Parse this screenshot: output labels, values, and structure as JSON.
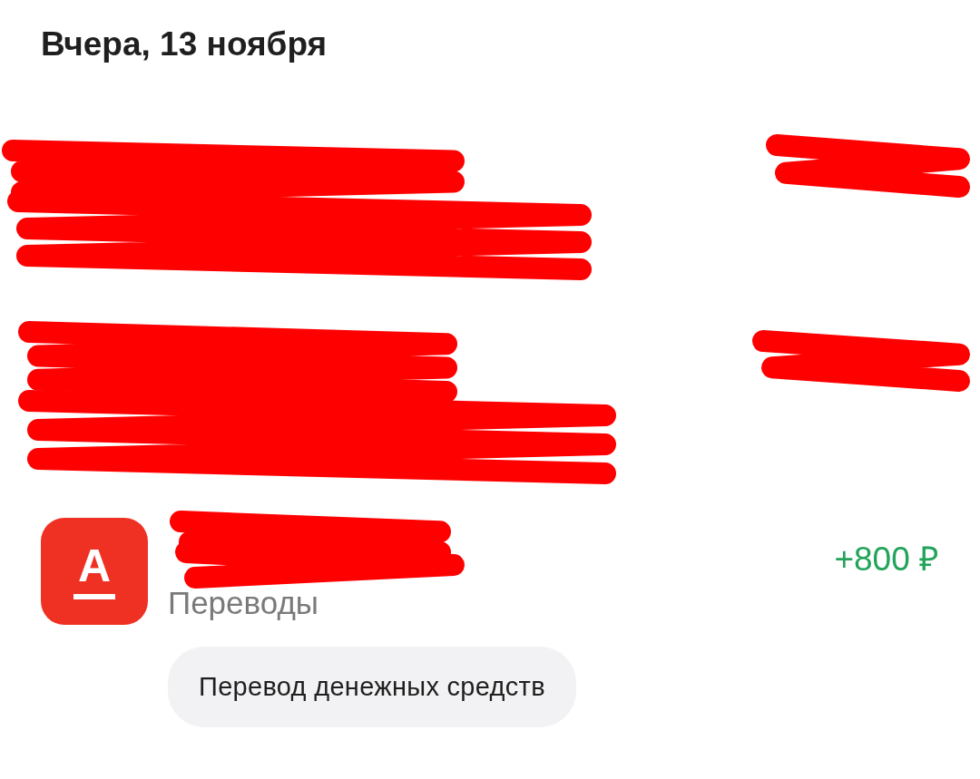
{
  "date_header": "Вчера, 13 ноября",
  "transactions": [
    {
      "kind": "redacted"
    },
    {
      "kind": "redacted"
    },
    {
      "kind": "transfer",
      "logo": "А",
      "category": "Переводы",
      "amount": "+800 ₽",
      "note": "Перевод денежных средств"
    }
  ]
}
